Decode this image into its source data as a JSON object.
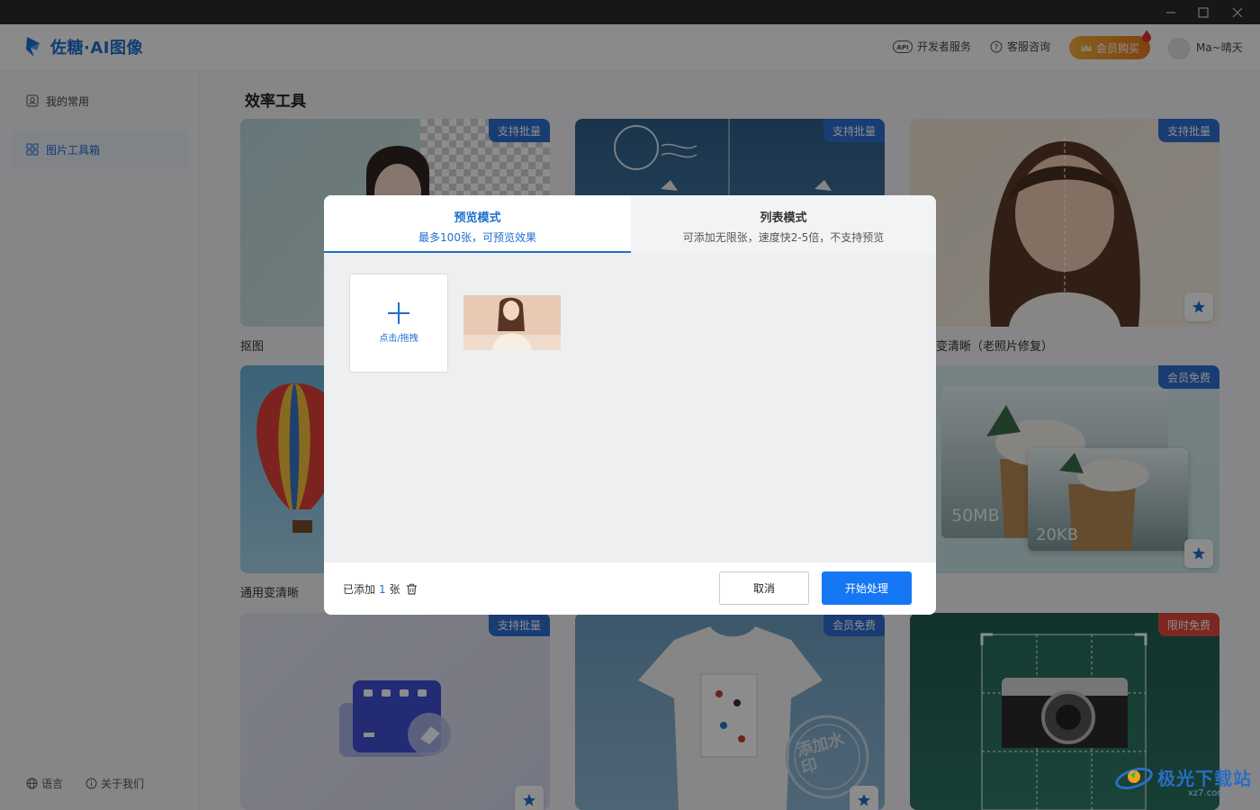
{
  "app": {
    "name": "佐糖·AI图像"
  },
  "header": {
    "developer": "开发者服务",
    "support": "客服咨询",
    "vip": "会员购买",
    "username": "Ma~晴天"
  },
  "sidebar": {
    "items": [
      {
        "label": "我的常用"
      },
      {
        "label": "图片工具箱"
      }
    ],
    "language": "语言",
    "about": "关于我们"
  },
  "main": {
    "section_title": "效率工具",
    "cards": [
      {
        "label": "抠图",
        "badge": "支持批量"
      },
      {
        "label": "",
        "badge": "支持批量"
      },
      {
        "label": "变清晰（老照片修复）",
        "badge": "支持批量"
      },
      {
        "label": "通用变清晰",
        "badge": ""
      },
      {
        "label": "",
        "badge": ""
      },
      {
        "label": "",
        "badge": "会员免费",
        "size_before": "50MB",
        "size_after": "20KB"
      },
      {
        "label": "",
        "badge": "支持批量"
      },
      {
        "label": "",
        "badge": "会员免费",
        "stamp": "添加水印"
      },
      {
        "label": "",
        "badge": "限时免费"
      }
    ]
  },
  "modal": {
    "tabs": [
      {
        "title": "预览模式",
        "subtitle": "最多100张，可预览效果"
      },
      {
        "title": "列表模式",
        "subtitle": "可添加无限张，速度快2-5倍，不支持预览"
      }
    ],
    "add_label": "点击/拖拽",
    "added_prefix": "已添加",
    "added_count": "1",
    "added_suffix": "张",
    "cancel": "取消",
    "start": "开始处理"
  },
  "watermark": {
    "text": "极光下载站",
    "sub": "xz7.com"
  }
}
